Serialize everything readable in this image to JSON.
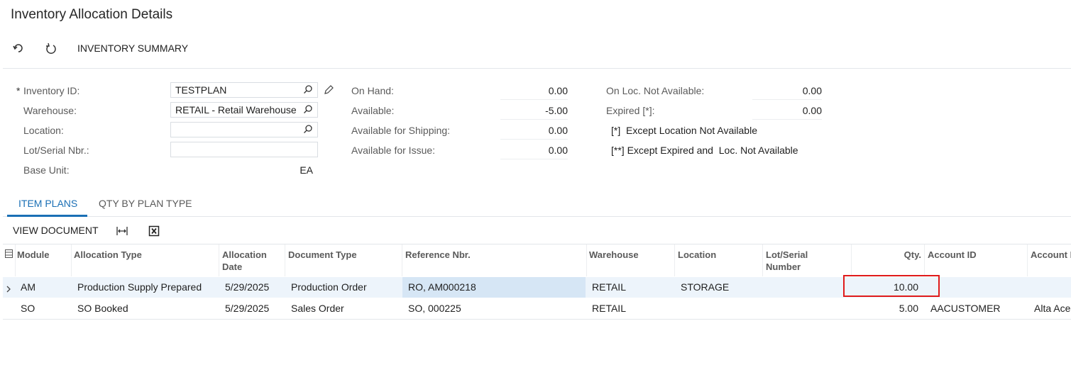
{
  "page": {
    "title": "Inventory Allocation Details"
  },
  "toolbar": {
    "summary_label": "INVENTORY SUMMARY",
    "undo_icon": "undo-icon",
    "refresh_icon": "refresh-icon"
  },
  "form": {
    "inventory_id_label": "Inventory ID:",
    "inventory_id_value": "TESTPLAN",
    "warehouse_label": "Warehouse:",
    "warehouse_value": "RETAIL - Retail Warehouse",
    "location_label": "Location:",
    "location_value": "",
    "lot_serial_label": "Lot/Serial Nbr.:",
    "lot_serial_value": "",
    "base_unit_label": "Base Unit:",
    "base_unit_value": "EA",
    "required_mark": "*"
  },
  "stats": {
    "on_hand_label": "On Hand:",
    "on_hand_value": "0.00",
    "available_label": "Available:",
    "available_value": "-5.00",
    "avail_shipping_label": "Available for Shipping:",
    "avail_shipping_value": "0.00",
    "avail_issue_label": "Available for Issue:",
    "avail_issue_value": "0.00",
    "on_loc_na_label": "On Loc. Not Available:",
    "on_loc_na_value": "0.00",
    "expired_label": "Expired [*]:",
    "expired_value": "0.00",
    "note1": "[*]  Except Location Not Available",
    "note2": "[**] Except Expired and  Loc. Not Available"
  },
  "tabs": [
    {
      "label": "ITEM PLANS",
      "active": true
    },
    {
      "label": "QTY BY PLAN TYPE",
      "active": false
    }
  ],
  "grid_toolbar": {
    "view_document_label": "VIEW DOCUMENT"
  },
  "grid": {
    "headers": {
      "module": "Module",
      "allocation_type": "Allocation Type",
      "allocation_date_1": "Allocation",
      "allocation_date_2": "Date",
      "document_type": "Document Type",
      "reference_nbr": "Reference Nbr.",
      "warehouse": "Warehouse",
      "location": "Location",
      "lot_serial_1": "Lot/Serial",
      "lot_serial_2": "Number",
      "qty": "Qty.",
      "account_id": "Account ID",
      "account_name": "Account N"
    },
    "rows": [
      {
        "module": "AM",
        "allocation_type": "Production Supply Prepared",
        "allocation_date": "5/29/2025",
        "document_type": "Production Order",
        "reference_nbr": "RO, AM000218",
        "warehouse": "RETAIL",
        "location": "STORAGE",
        "lot_serial": "",
        "qty": "10.00",
        "account_id": "",
        "account_name": ""
      },
      {
        "module": "SO",
        "allocation_type": "SO Booked",
        "allocation_date": "5/29/2025",
        "document_type": "Sales Order",
        "reference_nbr": "SO, 000225",
        "warehouse": "RETAIL",
        "location": "",
        "lot_serial": "",
        "qty": "5.00",
        "account_id": "AACUSTOMER",
        "account_name": "Alta Ace"
      }
    ]
  },
  "colors": {
    "accent": "#1a6fb5",
    "highlight_border": "#e01b1b",
    "selected_row": "#edf4fb"
  }
}
